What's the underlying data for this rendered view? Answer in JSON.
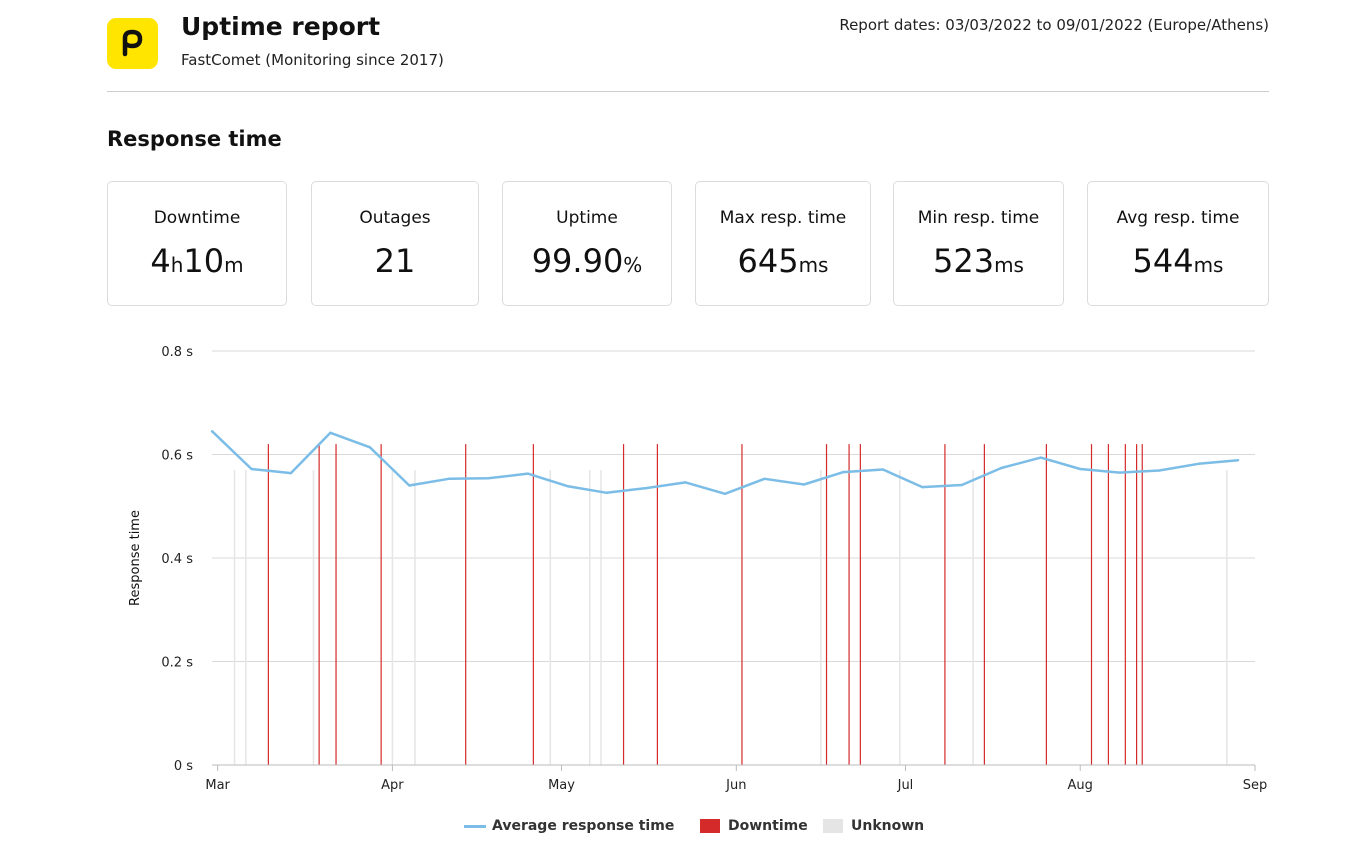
{
  "header": {
    "title": "Uptime report",
    "subtitle": "FastComet (Monitoring since 2017)",
    "report_dates": "Report dates: 03/03/2022 to 09/01/2022 (Europe/Athens)",
    "logo_icon": "pingdom-logo-icon",
    "logo_color": "#ffe500"
  },
  "section": {
    "title": "Response time"
  },
  "stats": [
    {
      "label": "Downtime",
      "parts": [
        {
          "v": "4",
          "u": ""
        },
        {
          "v": "",
          "u": "h"
        },
        {
          "v": "10",
          "u": ""
        },
        {
          "v": "",
          "u": "m"
        }
      ]
    },
    {
      "label": "Outages",
      "parts": [
        {
          "v": "21",
          "u": ""
        }
      ]
    },
    {
      "label": "Uptime",
      "parts": [
        {
          "v": "99.90",
          "u": ""
        },
        {
          "v": "",
          "u": "%"
        }
      ]
    },
    {
      "label": "Max resp. time",
      "parts": [
        {
          "v": "645",
          "u": ""
        },
        {
          "v": "",
          "u": "ms"
        }
      ]
    },
    {
      "label": "Min resp. time",
      "parts": [
        {
          "v": "523",
          "u": ""
        },
        {
          "v": "",
          "u": "ms"
        }
      ]
    },
    {
      "label": "Avg resp. time",
      "parts": [
        {
          "v": "544",
          "u": ""
        },
        {
          "v": "",
          "u": "ms"
        }
      ]
    }
  ],
  "colors": {
    "line": "#7bbde6",
    "downtime": "#d42a2a",
    "unknown": "#e5e5e5",
    "grid": "#d9d9d9"
  },
  "chart_data": {
    "type": "line",
    "xlabel": "",
    "ylabel": "Response time",
    "x_range": [
      "2022-02-28",
      "2022-09-01"
    ],
    "ylim": [
      0,
      0.8
    ],
    "y_ticks": [
      {
        "v": 0,
        "label": "0 s"
      },
      {
        "v": 0.2,
        "label": "0.2 s"
      },
      {
        "v": 0.4,
        "label": "0.4 s"
      },
      {
        "v": 0.6,
        "label": "0.6 s"
      },
      {
        "v": 0.8,
        "label": "0.8 s"
      }
    ],
    "x_ticks": [
      {
        "date": "2022-03-01",
        "label": "Mar"
      },
      {
        "date": "2022-04-01",
        "label": "Apr"
      },
      {
        "date": "2022-05-01",
        "label": "May"
      },
      {
        "date": "2022-06-01",
        "label": "Jun"
      },
      {
        "date": "2022-07-01",
        "label": "Jul"
      },
      {
        "date": "2022-08-01",
        "label": "Aug"
      },
      {
        "date": "2022-09-01",
        "label": "Sep"
      }
    ],
    "grid": true,
    "legend_position": "bottom",
    "series": [
      {
        "name": "Average response time",
        "points": [
          [
            "2022-02-28",
            0.645
          ],
          [
            "2022-03-07",
            0.572
          ],
          [
            "2022-03-14",
            0.564
          ],
          [
            "2022-03-21",
            0.642
          ],
          [
            "2022-03-28",
            0.614
          ],
          [
            "2022-04-04",
            0.54
          ],
          [
            "2022-04-11",
            0.553
          ],
          [
            "2022-04-18",
            0.554
          ],
          [
            "2022-04-25",
            0.563
          ],
          [
            "2022-05-02",
            0.539
          ],
          [
            "2022-05-09",
            0.526
          ],
          [
            "2022-05-16",
            0.535
          ],
          [
            "2022-05-23",
            0.546
          ],
          [
            "2022-05-30",
            0.524
          ],
          [
            "2022-06-06",
            0.553
          ],
          [
            "2022-06-13",
            0.542
          ],
          [
            "2022-06-20",
            0.566
          ],
          [
            "2022-06-27",
            0.571
          ],
          [
            "2022-07-04",
            0.537
          ],
          [
            "2022-07-11",
            0.541
          ],
          [
            "2022-07-18",
            0.574
          ],
          [
            "2022-07-25",
            0.594
          ],
          [
            "2022-08-01",
            0.572
          ],
          [
            "2022-08-08",
            0.565
          ],
          [
            "2022-08-15",
            0.569
          ],
          [
            "2022-08-22",
            0.582
          ],
          [
            "2022-08-29",
            0.589
          ]
        ]
      }
    ],
    "downtime_dates": [
      "2022-03-10",
      "2022-03-19",
      "2022-03-22",
      "2022-03-30",
      "2022-04-14",
      "2022-04-26",
      "2022-05-12",
      "2022-05-18",
      "2022-06-02",
      "2022-06-17",
      "2022-06-21",
      "2022-06-23",
      "2022-07-08",
      "2022-07-15",
      "2022-07-26",
      "2022-08-03",
      "2022-08-06",
      "2022-08-09",
      "2022-08-11",
      "2022-08-12"
    ],
    "unknown_dates": [
      "2022-03-04",
      "2022-03-06",
      "2022-03-18",
      "2022-04-01",
      "2022-04-05",
      "2022-04-29",
      "2022-05-06",
      "2022-05-08",
      "2022-06-16",
      "2022-06-30",
      "2022-07-13",
      "2022-08-27"
    ],
    "legend": [
      {
        "name": "Average response time",
        "kind": "line"
      },
      {
        "name": "Downtime",
        "kind": "downtime"
      },
      {
        "name": "Unknown",
        "kind": "unknown"
      }
    ]
  }
}
